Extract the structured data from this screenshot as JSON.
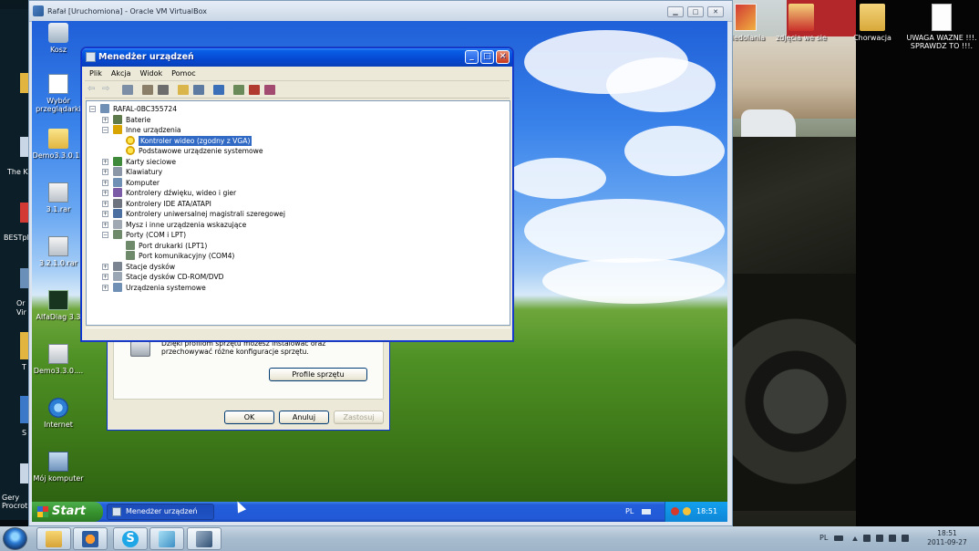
{
  "host": {
    "vm_window_title": "Rafał [Uruchomiona] - Oracle VM VirtualBox",
    "desktop_icons": [
      {
        "label": "Niedolania",
        "icon": "photo-icon"
      },
      {
        "label": "zdjęcia we sie",
        "icon": "biedronka-folder-icon"
      },
      {
        "label": "Chorwacja",
        "icon": "folder-icon"
      },
      {
        "label": "UWAGA WAZNE !!!. SPRAWDZ TO !!!.",
        "icon": "document-icon"
      }
    ],
    "left_strip_labels": [
      "The Ki",
      "BESTpl",
      "Or Vir",
      "T",
      "S",
      "Gery Procrot"
    ],
    "tray": {
      "lang": "PL",
      "time": "18:51",
      "date": "2011-09-27"
    },
    "taskbar_apps": [
      "explorer-icon",
      "media-player-icon",
      "skype-icon",
      "network-app-icon",
      "virtualbox-icon"
    ]
  },
  "xp": {
    "desktop_icons": [
      {
        "label": "Kosz",
        "icon": "recycle-bin-icon"
      },
      {
        "label": "Wybór przeglądarki",
        "icon": "browser-choice-icon"
      },
      {
        "label": "Demo3.3.0.11",
        "icon": "folder-icon"
      },
      {
        "label": "3.1.rar",
        "icon": "rar-archive-icon"
      },
      {
        "label": "3.2.1.0.rar",
        "icon": "rar-archive-icon"
      },
      {
        "label": "AlfaDiag 3.3",
        "icon": "alfadiag-icon"
      },
      {
        "label": "Demo3.3.0....",
        "icon": "rar-archive-icon"
      },
      {
        "label": "Internet",
        "icon": "internet-explorer-icon"
      },
      {
        "label": "Mój komputer",
        "icon": "my-computer-icon"
      }
    ],
    "taskbar": {
      "start_label": "Start",
      "task_label": "Menedżer urządzeń",
      "lang": "PL",
      "time": "18:51"
    }
  },
  "device_manager": {
    "title": "Menedżer urządzeń",
    "menu": [
      "Plik",
      "Akcja",
      "Widok",
      "Pomoc"
    ],
    "toolbar_icons": [
      "back-icon",
      "forward-icon",
      "view-icon",
      "properties-icon",
      "print-icon",
      "help-icon",
      "view-resources-icon",
      "scan-hardware-icon",
      "update-driver-icon",
      "uninstall-icon",
      "disable-icon"
    ],
    "tree": [
      {
        "label": "RAFAL-0BC355724",
        "level": 0,
        "expander": "−",
        "icon": "computer-icon"
      },
      {
        "label": "Baterie",
        "level": 1,
        "expander": "+",
        "icon": "battery-icon"
      },
      {
        "label": "Inne urządzenia",
        "level": 1,
        "expander": "−",
        "icon": "unknown-device-icon"
      },
      {
        "label": "Kontroler wideo (zgodny z VGA)",
        "level": 2,
        "expander": "",
        "icon": "warning-device-icon",
        "selected": true
      },
      {
        "label": "Podstawowe urządzenie systemowe",
        "level": 2,
        "expander": "",
        "icon": "warning-device-icon"
      },
      {
        "label": "Karty sieciowe",
        "level": 1,
        "expander": "+",
        "icon": "network-card-icon"
      },
      {
        "label": "Klawiatury",
        "level": 1,
        "expander": "+",
        "icon": "keyboard-icon"
      },
      {
        "label": "Komputer",
        "level": 1,
        "expander": "+",
        "icon": "computer-icon"
      },
      {
        "label": "Kontrolery dźwięku, wideo i gier",
        "level": 1,
        "expander": "+",
        "icon": "sound-icon"
      },
      {
        "label": "Kontrolery IDE ATA/ATAPI",
        "level": 1,
        "expander": "+",
        "icon": "ide-controller-icon"
      },
      {
        "label": "Kontrolery uniwersalnej magistrali szeregowej",
        "level": 1,
        "expander": "+",
        "icon": "usb-icon"
      },
      {
        "label": "Mysz i inne urządzenia wskazujące",
        "level": 1,
        "expander": "+",
        "icon": "mouse-icon"
      },
      {
        "label": "Porty (COM i LPT)",
        "level": 1,
        "expander": "−",
        "icon": "port-icon"
      },
      {
        "label": "Port drukarki (LPT1)",
        "level": 2,
        "expander": "",
        "icon": "port-icon"
      },
      {
        "label": "Port komunikacyjny (COM4)",
        "level": 2,
        "expander": "",
        "icon": "port-icon"
      },
      {
        "label": "Stacje dysków",
        "level": 1,
        "expander": "+",
        "icon": "floppy-icon"
      },
      {
        "label": "Stacje dysków CD-ROM/DVD",
        "level": 1,
        "expander": "+",
        "icon": "cdrom-icon"
      },
      {
        "label": "Urządzenia systemowe",
        "level": 1,
        "expander": "+",
        "icon": "system-device-icon"
      }
    ]
  },
  "system_properties": {
    "profiles_text": "Dzięki profilom sprzętu możesz instalować oraz przechowywać różne konfiguracje sprzętu.",
    "profiles_button": "Profile sprzętu",
    "ok": "OK",
    "cancel": "Anuluj",
    "apply": "Zastosuj"
  },
  "colors": {
    "xp_blue": "#0548d2",
    "selection": "#316ac5",
    "start_green": "#38942f"
  }
}
